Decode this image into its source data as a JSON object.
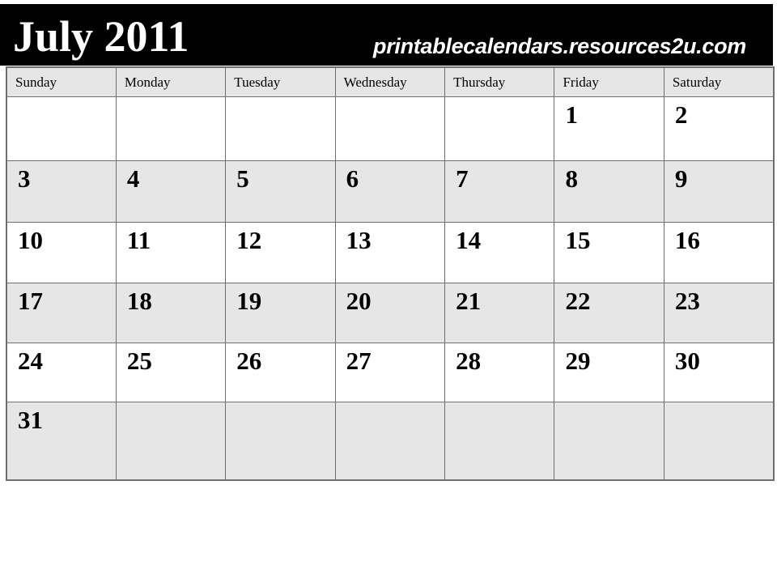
{
  "header": {
    "title": "July 2011",
    "month": "July",
    "year": "2011",
    "website_url": "printablecalendars.resources2u.com",
    "background_color": "#000000",
    "text_color": "#ffffff"
  },
  "calendar": {
    "weekday_headers": [
      "Sunday",
      "Monday",
      "Tuesday",
      "Wednesday",
      "Thursday",
      "Friday",
      "Saturday"
    ],
    "header_background_color": "#e6e6e6",
    "shaded_row_color": "#e6e6e6",
    "plain_row_color": "#ffffff",
    "border_color": "#6f6f6f",
    "weeks": [
      {
        "shaded": false,
        "days": [
          "",
          "",
          "",
          "",
          "",
          "1",
          "2"
        ]
      },
      {
        "shaded": true,
        "days": [
          "3",
          "4",
          "5",
          "6",
          "7",
          "8",
          "9"
        ]
      },
      {
        "shaded": false,
        "days": [
          "10",
          "11",
          "12",
          "13",
          "14",
          "15",
          "16"
        ]
      },
      {
        "shaded": true,
        "days": [
          "17",
          "18",
          "19",
          "20",
          "21",
          "22",
          "23"
        ]
      },
      {
        "shaded": false,
        "days": [
          "24",
          "25",
          "26",
          "27",
          "28",
          "29",
          "30"
        ]
      },
      {
        "shaded": true,
        "days": [
          "31",
          "",
          "",
          "",
          "",
          "",
          ""
        ]
      }
    ]
  }
}
